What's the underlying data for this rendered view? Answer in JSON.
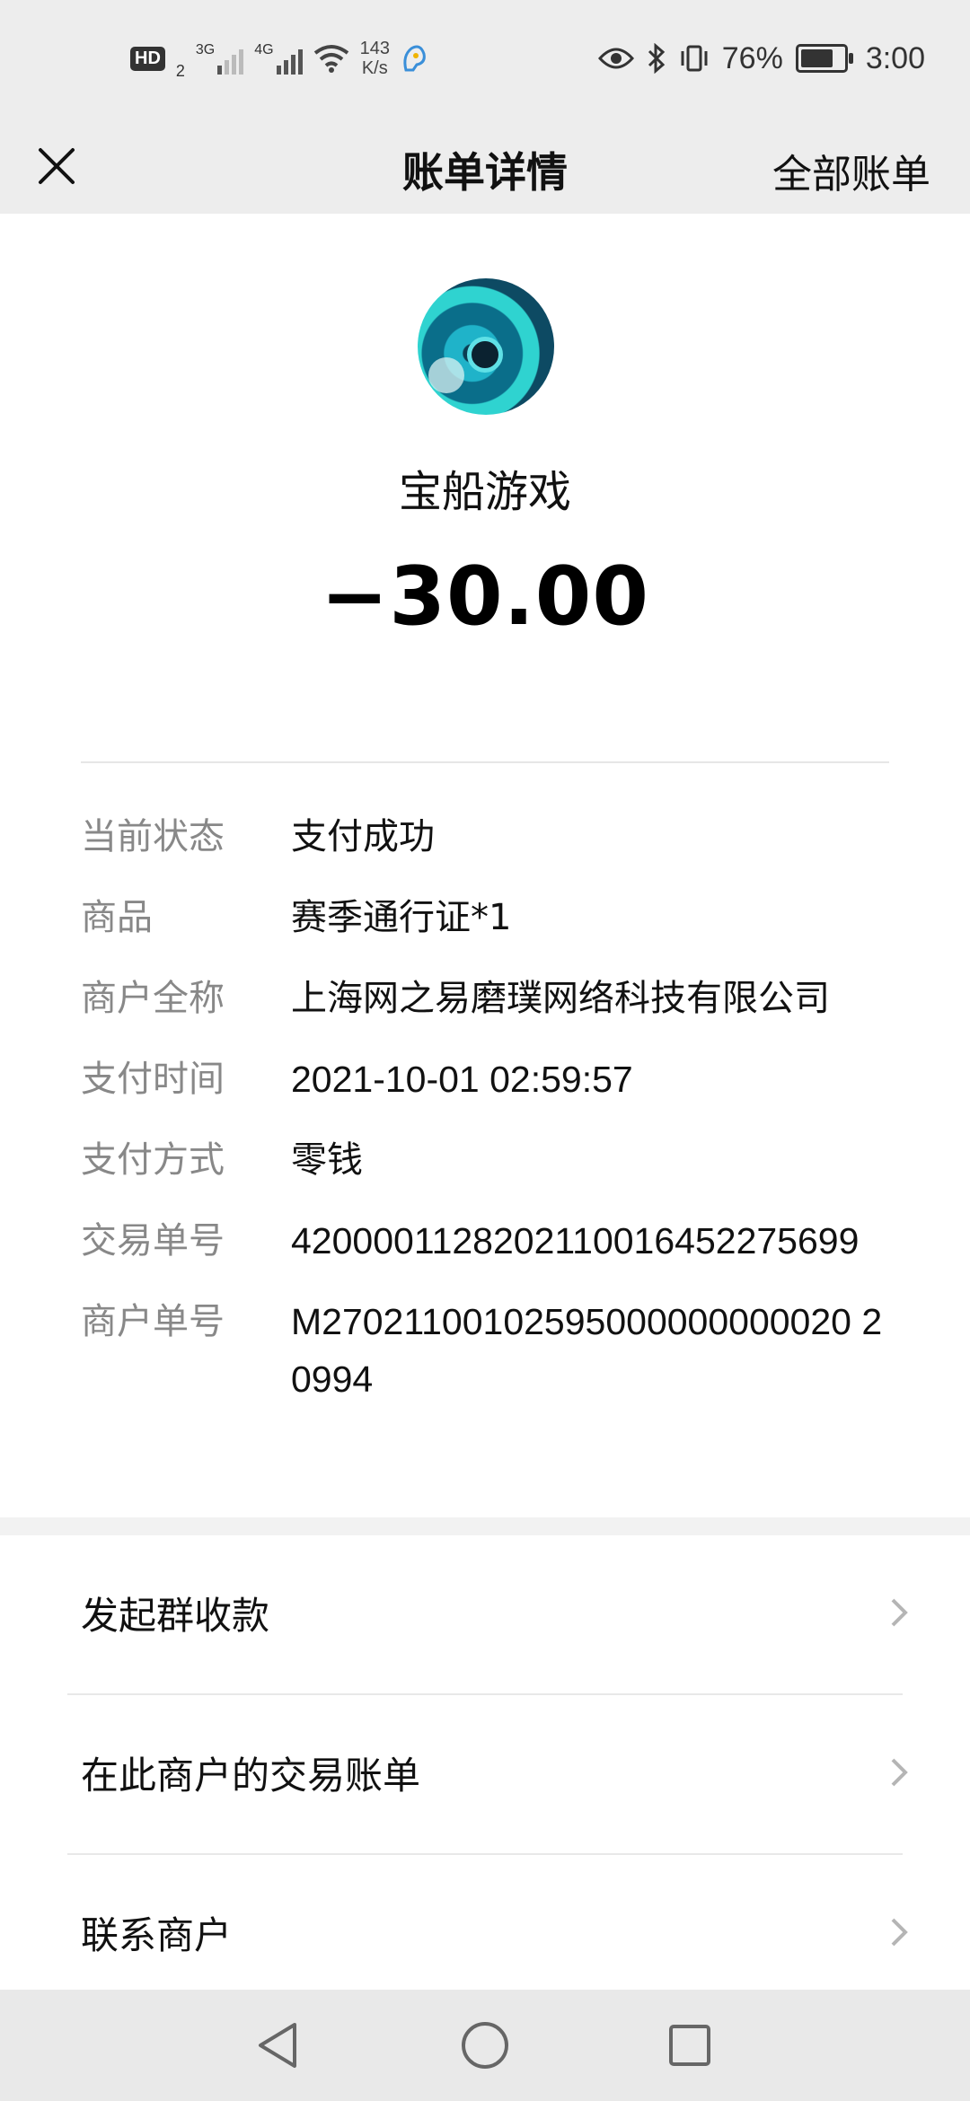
{
  "status_bar": {
    "hd_label": "HD",
    "hd_sub": "2",
    "net1": "3G",
    "net2": "4G",
    "speed_value": "143",
    "speed_unit": "K/s",
    "battery_percent": "76%",
    "battery_level": 0.76,
    "time": "3:00"
  },
  "header": {
    "title": "账单详情",
    "right_link": "全部账单",
    "close_icon": "close-icon"
  },
  "merchant": {
    "name": "宝船游戏",
    "amount": "−30.00",
    "avatar_icon": "merchant-avatar"
  },
  "details": [
    {
      "label": "当前状态",
      "value": "支付成功"
    },
    {
      "label": "商品",
      "value": "赛季通行证*1"
    },
    {
      "label": "商户全称",
      "value": "上海网之易磨璞网络科技有限公司"
    },
    {
      "label": "支付时间",
      "value": "2021-10-01 02:59:57"
    },
    {
      "label": "支付方式",
      "value": "零钱"
    },
    {
      "label": "交易单号",
      "value": "4200001128202110016452275699"
    },
    {
      "label": "商户单号",
      "value": "M27021100102595000000000020 20994"
    }
  ],
  "menu": [
    {
      "label": "发起群收款"
    },
    {
      "label": "在此商户的交易账单"
    },
    {
      "label": "联系商户"
    }
  ],
  "nav": {
    "back_icon": "back-triangle-icon",
    "home_icon": "home-circle-icon",
    "recents_icon": "recents-square-icon"
  },
  "colors": {
    "header_bg": "#ededed",
    "label_gray": "#888888",
    "text": "#111111"
  }
}
